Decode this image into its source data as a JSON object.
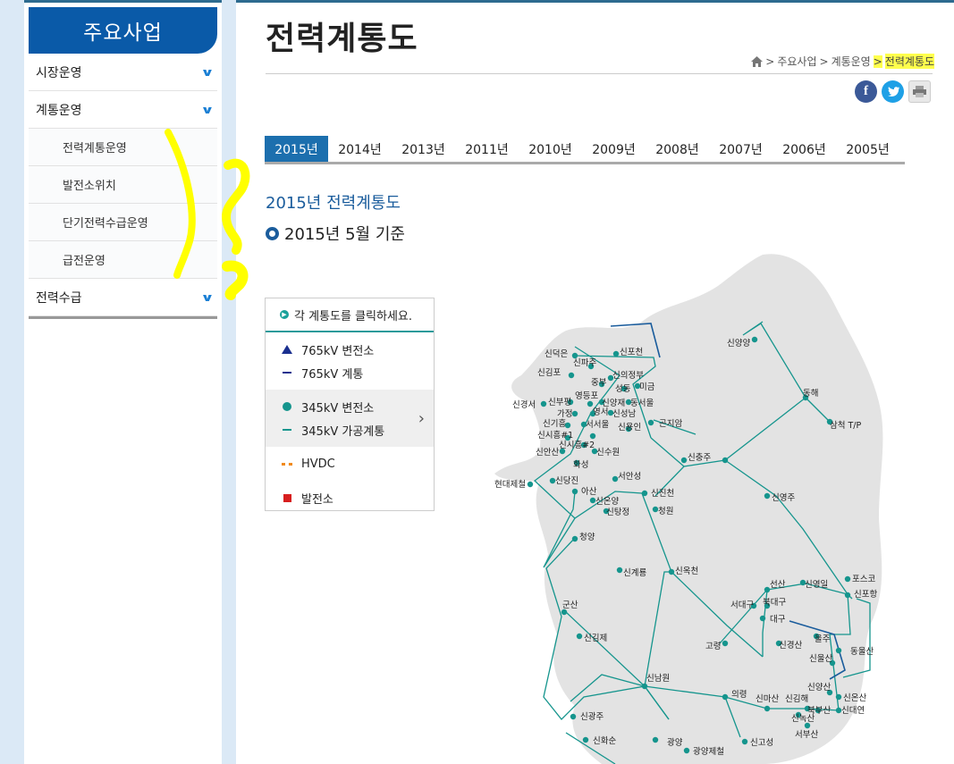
{
  "sidebar": {
    "title": "주요사업",
    "menu": [
      {
        "label": "시장운영"
      },
      {
        "label": "계통운영"
      },
      {
        "label": "전력수급"
      }
    ],
    "submenu": [
      {
        "label": "전력계통운영"
      },
      {
        "label": "발전소위치"
      },
      {
        "label": "단기전력수급운영"
      },
      {
        "label": "급전운영"
      }
    ]
  },
  "header": {
    "title": "전력계통도",
    "breadcrumb": [
      "주요사업",
      "계통운영",
      "전력계통도"
    ]
  },
  "share": {
    "facebook": "f",
    "twitter": "t",
    "print": "print"
  },
  "tabs": [
    "2015년",
    "2014년",
    "2013년",
    "2011년",
    "2010년",
    "2009년",
    "2008년",
    "2007년",
    "2006년",
    "2005년"
  ],
  "active_tab": "2015년",
  "content": {
    "subtitle": "2015년 전력계통도",
    "basis": "2015년 5월 기준"
  },
  "legend": {
    "header": "각 계통도를 클릭하세요.",
    "items_765": [
      "765kV 변전소",
      "765kV 계통"
    ],
    "items_345": [
      "345kV 변전소",
      "345kV 가공계통"
    ],
    "hvdc": "HVDC",
    "plant": "발전소"
  },
  "colors": {
    "accent": "#0a5aa8",
    "line": "#15958d",
    "highlight": "#ffff4d"
  },
  "map_labels": [
    "신양양",
    "동해",
    "삼척 T/P",
    "신덕은",
    "신포천",
    "신파주",
    "신김포",
    "중부",
    "신의정부",
    "성동",
    "미금",
    "신경서",
    "신부평",
    "영등포",
    "신양재",
    "동서울",
    "가정",
    "영서",
    "신성남",
    "신기흥",
    "서서울",
    "곤지암",
    "신시흥#1",
    "신시흥#2",
    "신용인",
    "신안산",
    "신수원",
    "신충주",
    "화성",
    "서안성",
    "현대제철",
    "신당진",
    "아산",
    "신진천",
    "신온양",
    "신탕정",
    "청원",
    "신영주",
    "청양",
    "신계룡",
    "신옥천",
    "선산",
    "신영일",
    "포스코",
    "신포항",
    "서대구",
    "북대구",
    "대구",
    "군산",
    "울주",
    "고령",
    "신경산",
    "동울산",
    "신김제",
    "신울산",
    "신남원",
    "신양산",
    "의령",
    "신마산",
    "신김해",
    "신온산",
    "북부산",
    "신대연",
    "신광주",
    "신녹산",
    "서부산",
    "신화순",
    "광양",
    "광양제철",
    "신고성"
  ]
}
